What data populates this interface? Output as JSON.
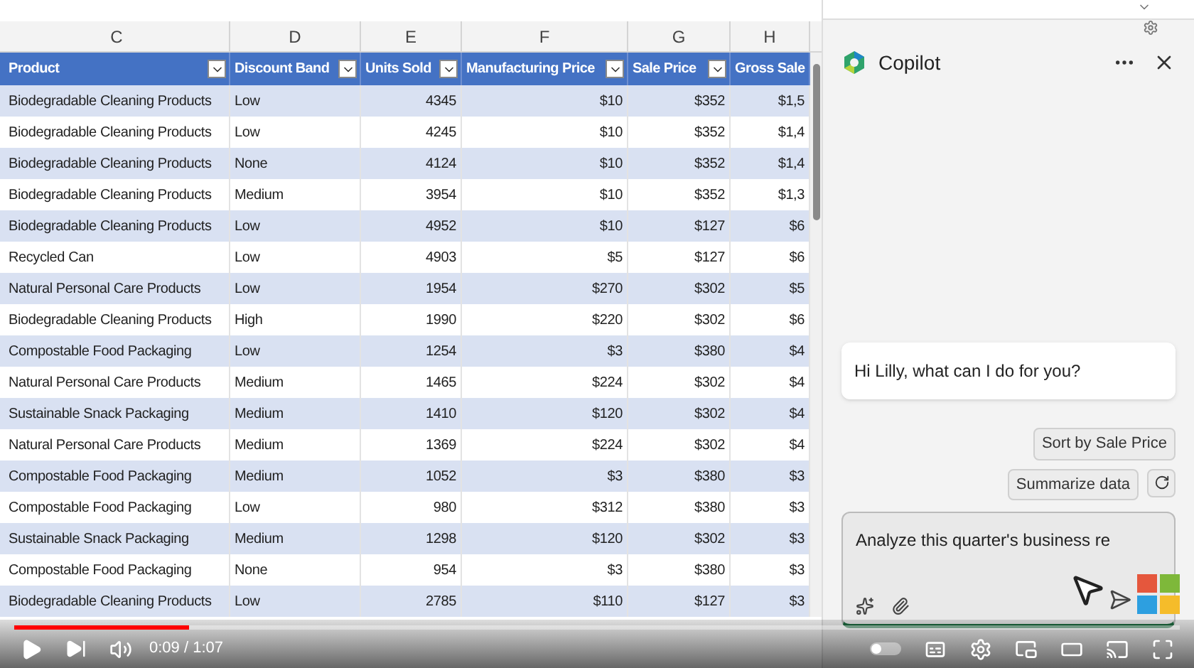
{
  "sheet": {
    "column_letters": [
      "C",
      "D",
      "E",
      "F",
      "G",
      "H"
    ],
    "columns": [
      "Product",
      "Discount Band",
      "Units Sold",
      "Manufacturing Price",
      "Sale Price",
      "Gross Sale"
    ],
    "rows": [
      [
        "Biodegradable Cleaning Products",
        "Low",
        "4345",
        "$10",
        "$352",
        "$1,5"
      ],
      [
        "Biodegradable Cleaning Products",
        "Low",
        "4245",
        "$10",
        "$352",
        "$1,4"
      ],
      [
        "Biodegradable Cleaning Products",
        "None",
        "4124",
        "$10",
        "$352",
        "$1,4"
      ],
      [
        "Biodegradable Cleaning Products",
        "Medium",
        "3954",
        "$10",
        "$352",
        "$1,3"
      ],
      [
        "Biodegradable Cleaning Products",
        "Low",
        "4952",
        "$10",
        "$127",
        "$6"
      ],
      [
        "Recycled Can",
        "Low",
        "4903",
        "$5",
        "$127",
        "$6"
      ],
      [
        "Natural Personal Care Products",
        "Low",
        "1954",
        "$270",
        "$302",
        "$5"
      ],
      [
        "Biodegradable Cleaning Products",
        "High",
        "1990",
        "$220",
        "$302",
        "$6"
      ],
      [
        "Compostable Food Packaging",
        "Low",
        "1254",
        "$3",
        "$380",
        "$4"
      ],
      [
        "Natural Personal Care Products",
        "Medium",
        "1465",
        "$224",
        "$302",
        "$4"
      ],
      [
        "Sustainable Snack Packaging",
        "Medium",
        "1410",
        "$120",
        "$302",
        "$4"
      ],
      [
        "Natural Personal Care Products",
        "Medium",
        "1369",
        "$224",
        "$302",
        "$4"
      ],
      [
        "Compostable Food Packaging",
        "Medium",
        "1052",
        "$3",
        "$380",
        "$3"
      ],
      [
        "Compostable Food Packaging",
        "Low",
        "980",
        "$312",
        "$380",
        "$3"
      ],
      [
        "Sustainable Snack Packaging",
        "Medium",
        "1298",
        "$120",
        "$302",
        "$3"
      ],
      [
        "Compostable Food Packaging",
        "None",
        "954",
        "$3",
        "$380",
        "$3"
      ],
      [
        "Biodegradable Cleaning Products",
        "Low",
        "2785",
        "$110",
        "$127",
        "$3"
      ]
    ]
  },
  "copilot": {
    "title": "Copilot",
    "greeting": "Hi Lilly, what can I do for you?",
    "suggestions": [
      "Sort by Sale Price",
      "Summarize data"
    ],
    "input": {
      "value": "Analyze this quarter's business re"
    }
  },
  "player": {
    "time": "0:09 / 1:07",
    "autoplay": {
      "on": false
    },
    "progress": {
      "level": 0.15
    }
  }
}
